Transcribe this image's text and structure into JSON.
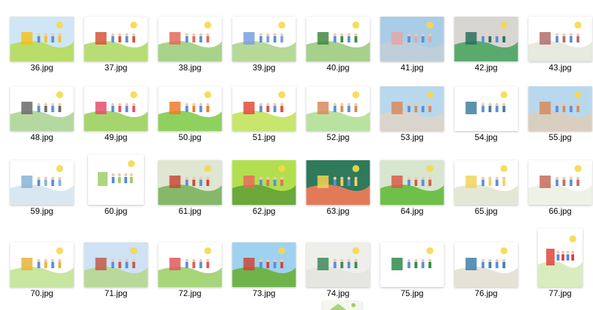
{
  "folder": {
    "items": [
      {
        "name": "36.jpg",
        "sky": "#cfe6f7",
        "ground": "#b9dd6a",
        "accent": "#f3c21b",
        "shape": "land"
      },
      {
        "name": "37.jpg",
        "sky": "#ffffff",
        "ground": "#b7de76",
        "accent": "#d3553a",
        "shape": "land"
      },
      {
        "name": "38.jpg",
        "sky": "#ffffff",
        "ground": "#a7d48a",
        "accent": "#e06a5a",
        "shape": "land"
      },
      {
        "name": "39.jpg",
        "sky": "#ffffff",
        "ground": "#b6d998",
        "accent": "#7a9fe0",
        "shape": "land"
      },
      {
        "name": "40.jpg",
        "sky": "#ffffff",
        "ground": "#a6d08b",
        "accent": "#3f8a3f",
        "shape": "land"
      },
      {
        "name": "41.jpg",
        "sky": "#a9cde6",
        "ground": "#bfcfd9",
        "accent": "#e4a4a4",
        "shape": "land"
      },
      {
        "name": "42.jpg",
        "sky": "#d8d6d2",
        "ground": "#5aaa6d",
        "accent": "#2f6e5f",
        "shape": "land"
      },
      {
        "name": "43.jpg",
        "sky": "#ffffff",
        "ground": "#e7eadf",
        "accent": "#b46b6b",
        "shape": "land"
      },
      {
        "name": "48.jpg",
        "sky": "#ffffff",
        "ground": "#b5d8a0",
        "accent": "#6a6a6a",
        "shape": "land"
      },
      {
        "name": "49.jpg",
        "sky": "#ffffff",
        "ground": "#a6d56d",
        "accent": "#e44e6e",
        "shape": "land"
      },
      {
        "name": "50.jpg",
        "sky": "#ffffff",
        "ground": "#8fd15f",
        "accent": "#f07a2a",
        "shape": "land"
      },
      {
        "name": "51.jpg",
        "sky": "#ffffff",
        "ground": "#c8e66e",
        "accent": "#e34a3a",
        "shape": "land"
      },
      {
        "name": "52.jpg",
        "sky": "#ffffff",
        "ground": "#b9e2a0",
        "accent": "#d88b5a",
        "shape": "land"
      },
      {
        "name": "53.jpg",
        "sky": "#b8d8ee",
        "ground": "#d9d5cc",
        "accent": "#d88a5a",
        "shape": "land"
      },
      {
        "name": "54.jpg",
        "sky": "#ffffff",
        "ground": "#ffffff",
        "accent": "#3f7f9f",
        "shape": "land"
      },
      {
        "name": "55.jpg",
        "sky": "#b8d8ee",
        "ground": "#d8cfc0",
        "accent": "#d88a5a",
        "shape": "land"
      },
      {
        "name": "59.jpg",
        "sky": "#ffffff",
        "ground": "#d9e8f0",
        "accent": "#86b4d8",
        "shape": "land"
      },
      {
        "name": "60.jpg",
        "sky": "#ffffff",
        "ground": "#ffffff",
        "accent": "#9fcf6a",
        "shape": "square"
      },
      {
        "name": "61.jpg",
        "sky": "#dfe6d2",
        "ground": "#86b86a",
        "accent": "#c84a3a",
        "shape": "land"
      },
      {
        "name": "62.jpg",
        "sky": "#b2df4e",
        "ground": "#6aa93a",
        "accent": "#e96a5a",
        "shape": "land"
      },
      {
        "name": "63.jpg",
        "sky": "#2f7a5a",
        "ground": "#e27a5a",
        "accent": "#f2d35a",
        "shape": "land"
      },
      {
        "name": "64.jpg",
        "sky": "#d8e6d0",
        "ground": "#6fc04a",
        "accent": "#d95a4a",
        "shape": "land"
      },
      {
        "name": "65.jpg",
        "sky": "#ffffff",
        "ground": "#e3e8d6",
        "accent": "#f2d35a",
        "shape": "land"
      },
      {
        "name": "66.jpg",
        "sky": "#ffffff",
        "ground": "#eef2e6",
        "accent": "#c76a5a",
        "shape": "land"
      },
      {
        "name": "70.jpg",
        "sky": "#ffffff",
        "ground": "#c8e6a0",
        "accent": "#e8b43a",
        "shape": "land"
      },
      {
        "name": "71.jpg",
        "sky": "#cfe2f4",
        "ground": "#b9d99a",
        "accent": "#c25a4a",
        "shape": "land"
      },
      {
        "name": "72.jpg",
        "sky": "#ffffff",
        "ground": "#a6d57a",
        "accent": "#e05a5a",
        "shape": "land"
      },
      {
        "name": "73.jpg",
        "sky": "#9fd2ef",
        "ground": "#6fb44a",
        "accent": "#d0443a",
        "shape": "land"
      },
      {
        "name": "74.jpg",
        "sky": "#eeeeea",
        "ground": "#e6e6e0",
        "accent": "#3d8a5a",
        "shape": "land"
      },
      {
        "name": "75.jpg",
        "sky": "#ffffff",
        "ground": "#ffffff",
        "accent": "#2f8a4a",
        "shape": "land"
      },
      {
        "name": "76.jpg",
        "sky": "#ffffff",
        "ground": "#e6e3d6",
        "accent": "#3f7fae",
        "shape": "land"
      },
      {
        "name": "77.jpg",
        "sky": "#ffffff",
        "ground": "#d9ecc0",
        "accent": "#e2443a",
        "shape": "port"
      }
    ]
  }
}
